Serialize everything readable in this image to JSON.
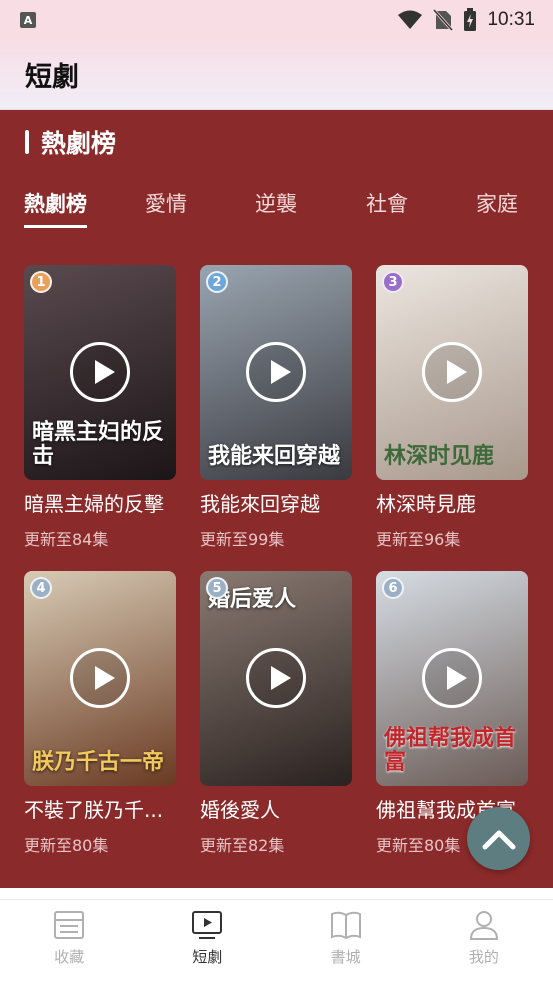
{
  "status": {
    "time": "10:31",
    "left_icon": "A"
  },
  "header": {
    "title": "短劇"
  },
  "section": {
    "title": "熱劇榜"
  },
  "tabs": [
    "熱劇榜",
    "愛情",
    "逆襲",
    "社會",
    "家庭"
  ],
  "dramas": [
    {
      "rank": "1",
      "title": "暗黑主婦的反擊",
      "episodes": "更新至84集",
      "poster_text": "暗黑主妇的反击",
      "colors": [
        "#5a4a4f",
        "#1c1517"
      ],
      "rank_color": "#e8a05a"
    },
    {
      "rank": "2",
      "title": "我能來回穿越",
      "episodes": "更新至99集",
      "poster_text": "我能来回穿越",
      "colors": [
        "#9aa5b0",
        "#3a3a40"
      ],
      "rank_color": "#6fa6d8"
    },
    {
      "rank": "3",
      "title": "林深時見鹿",
      "episodes": "更新至96集",
      "poster_text": "林深时见鹿",
      "colors": [
        "#ece6e0",
        "#a8988c"
      ],
      "rank_color": "#9a6fc8"
    },
    {
      "rank": "4",
      "title": "不裝了朕乃千...",
      "episodes": "更新至80集",
      "poster_text": "朕乃千古一帝",
      "colors": [
        "#d8cbb6",
        "#6a3a22"
      ],
      "rank_color": "#9bb0c4"
    },
    {
      "rank": "5",
      "title": "婚後愛人",
      "episodes": "更新至82集",
      "poster_text": "婚后爱人",
      "colors": [
        "#8a7a72",
        "#2a2220"
      ],
      "rank_color": "#9bb0c4"
    },
    {
      "rank": "6",
      "title": "佛祖幫我成首富",
      "episodes": "更新至80集",
      "poster_text": "佛祖帮我成首富",
      "colors": [
        "#d6dde4",
        "#6a5a55"
      ],
      "rank_color": "#9bb0c4"
    }
  ],
  "bottom_nav": [
    {
      "label": "收藏",
      "icon": "list-icon",
      "active": false
    },
    {
      "label": "短劇",
      "icon": "tv-play-icon",
      "active": true
    },
    {
      "label": "書城",
      "icon": "book-icon",
      "active": false
    },
    {
      "label": "我的",
      "icon": "person-icon",
      "active": false
    }
  ]
}
